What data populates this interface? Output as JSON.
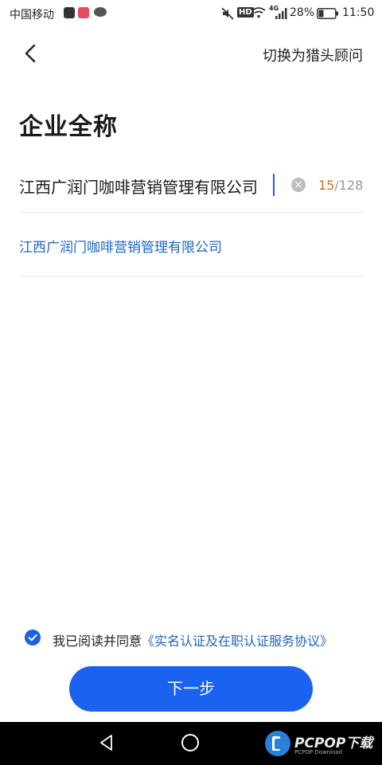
{
  "status_bar": {
    "carrier": "中国移动",
    "hd_badge": "HD",
    "network": "4G",
    "battery_percent": "28%",
    "time": "11:50"
  },
  "nav": {
    "back_icon": "chevron-left-icon",
    "switch_label": "切换为猎头顾问"
  },
  "page": {
    "title": "企业全称"
  },
  "company_input": {
    "value": "江西广润门咖啡营销管理有限公司",
    "count_current": "15",
    "count_max": "/128",
    "clear_icon": "clear-icon"
  },
  "suggestions": [
    {
      "label": "江西广润门咖啡营销管理有限公司"
    }
  ],
  "agreement": {
    "prefix": "我已阅读并同意",
    "link": "《实名认证及在职认证服务协议》",
    "checked": true
  },
  "next_button": {
    "label": "下一步"
  },
  "watermark": {
    "brand": "PCPOP下载",
    "sub": "PCPOP Download"
  },
  "colors": {
    "accent": "#1a63f0",
    "link": "#1d66c6",
    "counter_current": "#e06a1f"
  }
}
